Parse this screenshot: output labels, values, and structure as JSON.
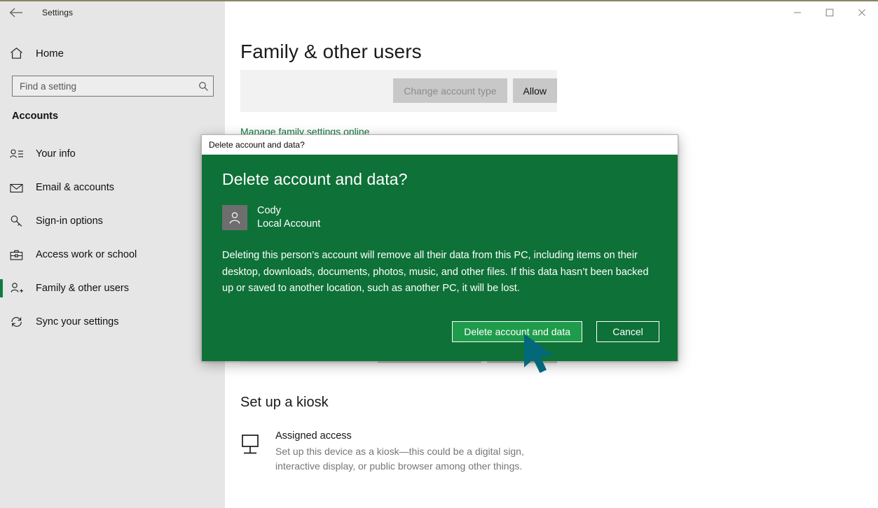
{
  "window": {
    "app_title": "Settings",
    "back_icon": "back-arrow-icon",
    "controls": {
      "minimize": "—",
      "maximize": "□",
      "close": "✕"
    }
  },
  "sidebar": {
    "home_label": "Home",
    "home_icon": "home-icon",
    "search": {
      "placeholder": "Find a setting",
      "value": "",
      "icon": "search-icon"
    },
    "section_title": "Accounts",
    "items": [
      {
        "label": "Your info",
        "icon": "person-info-icon",
        "active": false
      },
      {
        "label": "Email & accounts",
        "icon": "envelope-icon",
        "active": false
      },
      {
        "label": "Sign-in options",
        "icon": "key-icon",
        "active": false
      },
      {
        "label": "Access work or school",
        "icon": "briefcase-icon",
        "active": false
      },
      {
        "label": "Family & other users",
        "icon": "person-add-icon",
        "active": true
      },
      {
        "label": "Sync your settings",
        "icon": "sync-icon",
        "active": false
      }
    ]
  },
  "main": {
    "page_title": "Family & other users",
    "account_panel": {
      "change_account_type_label": "Change account type",
      "change_account_type_disabled": true,
      "allow_label": "Allow"
    },
    "manage_family_link": "Manage family settings online",
    "kiosk": {
      "section_title": "Set up a kiosk",
      "icon": "monitor-kiosk-icon",
      "item_name": "Assigned access",
      "item_desc": "Set up this device as a kiosk—this could be a digital sign, interactive display, or public browser among other things."
    }
  },
  "dialog": {
    "titlebar_text": "Delete account and data?",
    "heading": "Delete account and data?",
    "avatar_icon": "person-avatar-icon",
    "user_name": "Cody",
    "user_type": "Local Account",
    "message": "Deleting this person’s account will remove all their data from this PC, including items on their desktop, downloads, documents, photos, music, and other files. If this data hasn’t been backed up or saved to another location, such as another PC, it will be lost.",
    "confirm_label": "Delete account and data",
    "cancel_label": "Cancel"
  },
  "cursor": {
    "icon": "mouse-pointer-icon",
    "color": "#03687a"
  },
  "colors": {
    "accent_green": "#107c41",
    "dialog_green": "#0e7138",
    "primary_button_green": "#1f9c4b",
    "link_green": "#13773d",
    "sidebar_bg": "#e6e6e6",
    "cursor_teal": "#03687a"
  }
}
